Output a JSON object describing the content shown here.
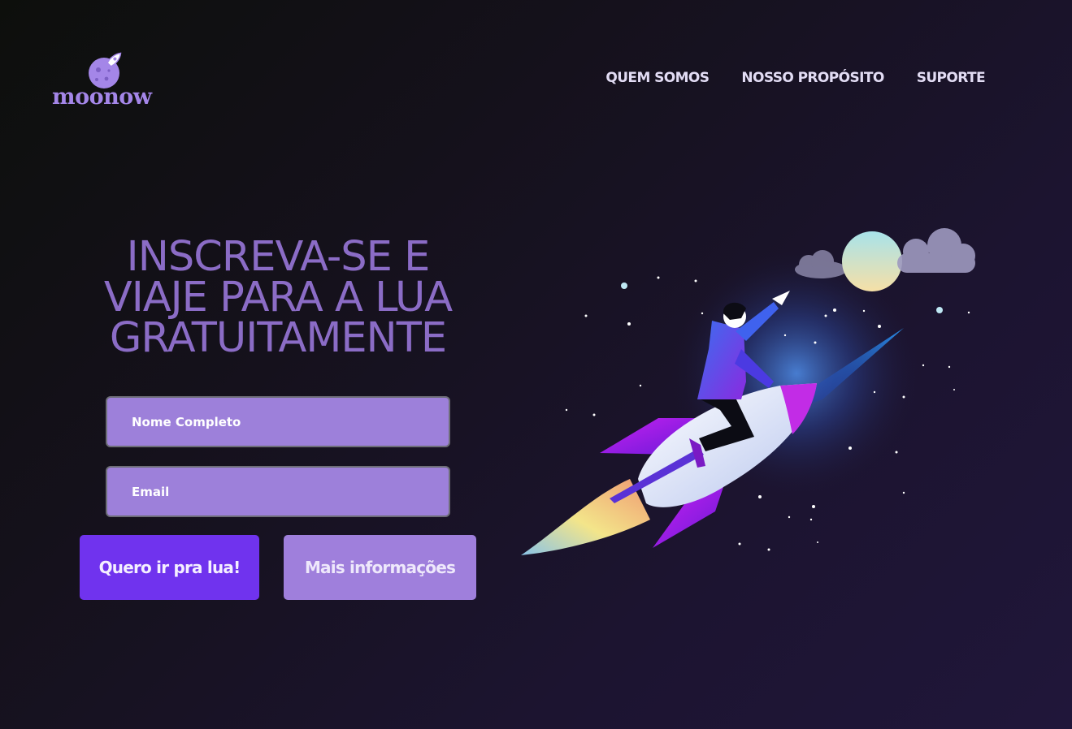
{
  "brand": {
    "name": "moonow",
    "accent_color": "#a486e8",
    "logo_icon": "moon-rocket-icon"
  },
  "nav": {
    "items": [
      {
        "label": "QUEM SOMOS"
      },
      {
        "label": "NOSSO PROPÓSITO"
      },
      {
        "label": "SUPORTE"
      }
    ]
  },
  "hero": {
    "headline_lines": [
      "INSCREVA-SE E",
      "VIAJE PARA A LUA",
      "GRATUITAMENTE"
    ],
    "headline_color": "#8b6cc6",
    "illustration": "man-riding-rocket-to-moon-illustration"
  },
  "form": {
    "name_placeholder": "Nome Completo",
    "email_placeholder": "Email",
    "field_color": "#9d80da"
  },
  "buttons": {
    "primary_label": "Quero ir pra lua!",
    "primary_color": "#7033ee",
    "secondary_label": "Mais informações",
    "secondary_color": "#9f7fdc"
  }
}
